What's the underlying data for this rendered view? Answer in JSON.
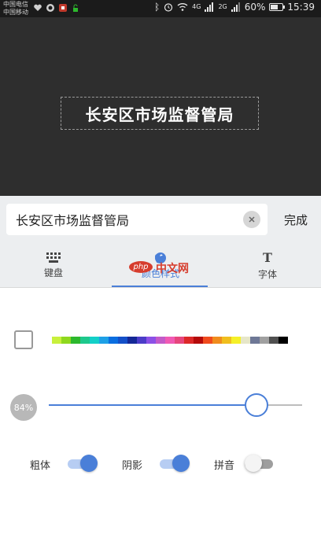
{
  "status_bar": {
    "carrier_1": "中国电信",
    "carrier_2": "中国移动",
    "network_1": "4G",
    "network_2": "2G",
    "battery": "60%",
    "battery_level": 0.6,
    "time": "15:39"
  },
  "preview": {
    "text": "长安区市场监督管局"
  },
  "editor": {
    "input_value": "长安区市场监督管局",
    "clear_icon": "close-icon",
    "done_label": "完成"
  },
  "tabs": [
    {
      "label": "键盘",
      "icon": "keyboard-icon"
    },
    {
      "label": "颜色样式",
      "icon": "palette-icon",
      "active": true
    },
    {
      "label": "字体",
      "icon": "font-icon"
    }
  ],
  "watermark": {
    "badge": "php",
    "text": "中文网"
  },
  "colors": {
    "accent": "#4a7fd8",
    "palette": [
      "#c8f03c",
      "#8fd81e",
      "#2db82d",
      "#1ec88c",
      "#13d0c8",
      "#1ea0e6",
      "#0a6ee0",
      "#1450c8",
      "#142896",
      "#4b3cc8",
      "#8c50e6",
      "#c35ac8",
      "#f05ab4",
      "#e6467d",
      "#dc2828",
      "#b40a0a",
      "#f04b1e",
      "#f08c1e",
      "#f0be1e",
      "#f5f028",
      "#e6e6c8",
      "#6e7896",
      "#a0a0a0",
      "#505050",
      "#000000"
    ]
  },
  "opacity": {
    "label": "84%",
    "value": 0.84
  },
  "toggles": [
    {
      "label": "粗体",
      "on": true
    },
    {
      "label": "阴影",
      "on": true
    },
    {
      "label": "拼音",
      "on": false
    }
  ]
}
